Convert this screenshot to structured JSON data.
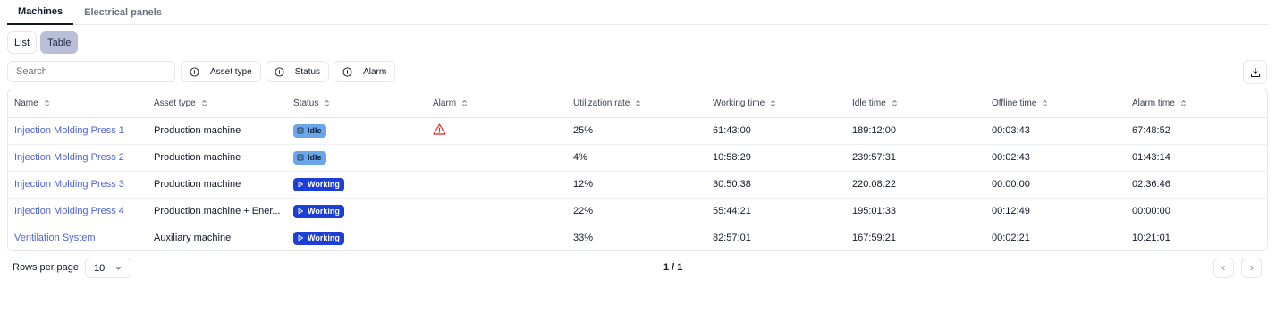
{
  "tabs": [
    {
      "label": "Machines",
      "active": true
    },
    {
      "label": "Electrical panels",
      "active": false
    }
  ],
  "views": {
    "list": "List",
    "table": "Table",
    "active": "Table"
  },
  "search": {
    "placeholder": "Search",
    "value": ""
  },
  "filters": {
    "asset_type": "Asset type",
    "status": "Status",
    "alarm": "Alarm"
  },
  "icons": {
    "filter": "plus-circle-icon",
    "download": "download-icon",
    "sort": "sort-icon",
    "idle": "pause-icon",
    "working": "play-icon",
    "alarm": "warning-triangle-icon",
    "select": "chevron-down-icon",
    "prev": "chevron-left-icon",
    "next": "chevron-right-icon"
  },
  "colors": {
    "link": "#4f63d2",
    "idle_badge": "#6aa6e8",
    "working_badge": "#1e3fd6",
    "alarm": "#dc2626",
    "active_view": "#b9bfd8"
  },
  "table": {
    "columns": [
      "Name",
      "Asset type",
      "Status",
      "Alarm",
      "Utilization rate",
      "Working time",
      "Idle time",
      "Offline time",
      "Alarm time"
    ],
    "rows": [
      {
        "name": "Injection Molding Press 1",
        "asset_type": "Production machine",
        "status": "Idle",
        "alarm": true,
        "utilization": "25%",
        "working_time": "61:43:00",
        "idle_time": "189:12:00",
        "offline_time": "00:03:43",
        "alarm_time": "67:48:52"
      },
      {
        "name": "Injection Molding Press 2",
        "asset_type": "Production machine",
        "status": "Idle",
        "alarm": false,
        "utilization": "4%",
        "working_time": "10:58:29",
        "idle_time": "239:57:31",
        "offline_time": "00:02:43",
        "alarm_time": "01:43:14"
      },
      {
        "name": "Injection Molding Press 3",
        "asset_type": "Production machine",
        "status": "Working",
        "alarm": false,
        "utilization": "12%",
        "working_time": "30:50:38",
        "idle_time": "220:08:22",
        "offline_time": "00:00:00",
        "alarm_time": "02:36:46"
      },
      {
        "name": "Injection Molding Press 4",
        "asset_type": "Production machine + Ener...",
        "status": "Working",
        "alarm": false,
        "utilization": "22%",
        "working_time": "55:44:21",
        "idle_time": "195:01:33",
        "offline_time": "00:12:49",
        "alarm_time": "00:00:00"
      },
      {
        "name": "Ventilation System",
        "asset_type": "Auxiliary machine",
        "status": "Working",
        "alarm": false,
        "utilization": "33%",
        "working_time": "82:57:01",
        "idle_time": "167:59:21",
        "offline_time": "00:02:21",
        "alarm_time": "10:21:01"
      }
    ]
  },
  "footer": {
    "rows_per_page_label": "Rows per page",
    "rows_per_page": "10",
    "page_info": "1 / 1"
  }
}
